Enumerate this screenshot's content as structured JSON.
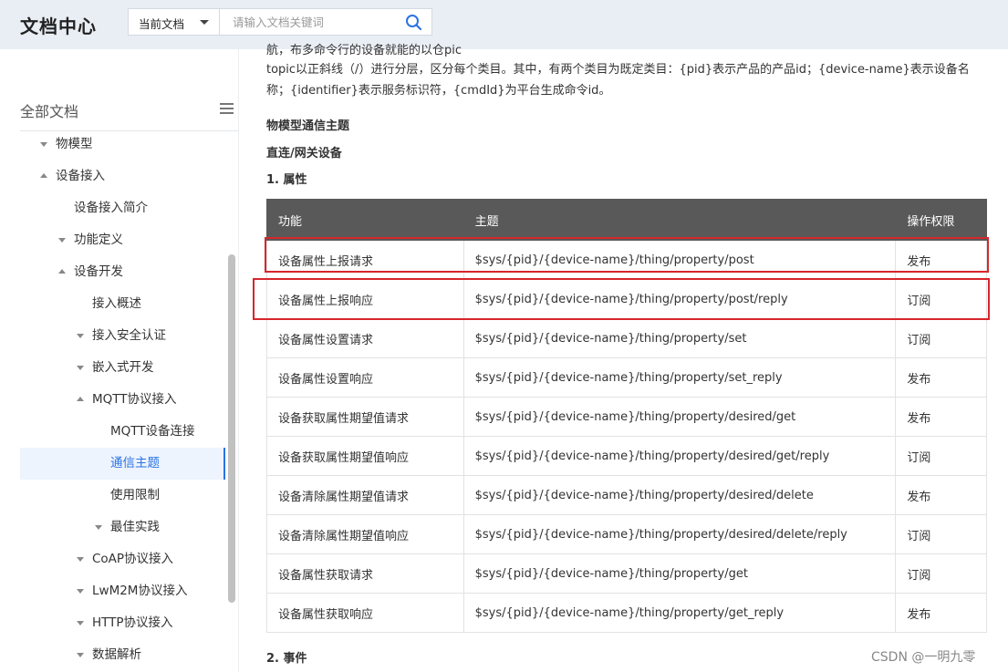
{
  "header": {
    "logo": "文档中心",
    "scope_label": "当前文档",
    "search_placeholder": "请输入文档关键词"
  },
  "sidebar": {
    "title": "全部文档",
    "items": [
      {
        "label": "物模型",
        "caret": "down"
      },
      {
        "label": "设备接入",
        "caret": "up"
      },
      {
        "label": "设备接入简介",
        "caret": ""
      },
      {
        "label": "功能定义",
        "caret": "down"
      },
      {
        "label": "设备开发",
        "caret": "up"
      },
      {
        "label": "接入概述",
        "caret": ""
      },
      {
        "label": "接入安全认证",
        "caret": "down"
      },
      {
        "label": "嵌入式开发",
        "caret": "down"
      },
      {
        "label": "MQTT协议接入",
        "caret": "up"
      },
      {
        "label": "MQTT设备连接",
        "caret": ""
      },
      {
        "label": "通信主题",
        "caret": "",
        "active": true
      },
      {
        "label": "使用限制",
        "caret": ""
      },
      {
        "label": "最佳实践",
        "caret": "down"
      },
      {
        "label": "CoAP协议接入",
        "caret": "down"
      },
      {
        "label": "LwM2M协议接入",
        "caret": "down"
      },
      {
        "label": "HTTP协议接入",
        "caret": "down"
      },
      {
        "label": "数据解析",
        "caret": "down"
      }
    ]
  },
  "content": {
    "clipped_line": "航，布多命令行的设备就能的以仓pic",
    "intro": "topic以正斜线（/）进行分层，区分每个类目。其中，有两个类目为既定类目：{pid}表示产品的产品id；{device-name}表示设备名称；{identifier}表示服务标识符，{cmdId}为平台生成命令id。",
    "section_title": "物模型通信主题",
    "subsection_title": "直连/网关设备",
    "heading_property": "1. 属性",
    "heading_event": "2. 事件",
    "table": {
      "headers": [
        "功能",
        "主题",
        "操作权限"
      ],
      "rows": [
        [
          "设备属性上报请求",
          "$sys/{pid}/{device-name}/thing/property/post",
          "发布"
        ],
        [
          "设备属性上报响应",
          "$sys/{pid}/{device-name}/thing/property/post/reply",
          "订阅"
        ],
        [
          "设备属性设置请求",
          "$sys/{pid}/{device-name}/thing/property/set",
          "订阅"
        ],
        [
          "设备属性设置响应",
          "$sys/{pid}/{device-name}/thing/property/set_reply",
          "发布"
        ],
        [
          "设备获取属性期望值请求",
          "$sys/{pid}/{device-name}/thing/property/desired/get",
          "发布"
        ],
        [
          "设备获取属性期望值响应",
          "$sys/{pid}/{device-name}/thing/property/desired/get/reply",
          "订阅"
        ],
        [
          "设备清除属性期望值请求",
          "$sys/{pid}/{device-name}/thing/property/desired/delete",
          "发布"
        ],
        [
          "设备清除属性期望值响应",
          "$sys/{pid}/{device-name}/thing/property/desired/delete/reply",
          "订阅"
        ],
        [
          "设备属性获取请求",
          "$sys/{pid}/{device-name}/thing/property/get",
          "订阅"
        ],
        [
          "设备属性获取响应",
          "$sys/{pid}/{device-name}/thing/property/get_reply",
          "发布"
        ]
      ]
    }
  },
  "watermark": "CSDN @一明九零",
  "colors": {
    "header_bg": "#e9eef5",
    "table_header_bg": "#595959",
    "accent": "#2b73e4",
    "highlight_border": "#d6262c"
  }
}
